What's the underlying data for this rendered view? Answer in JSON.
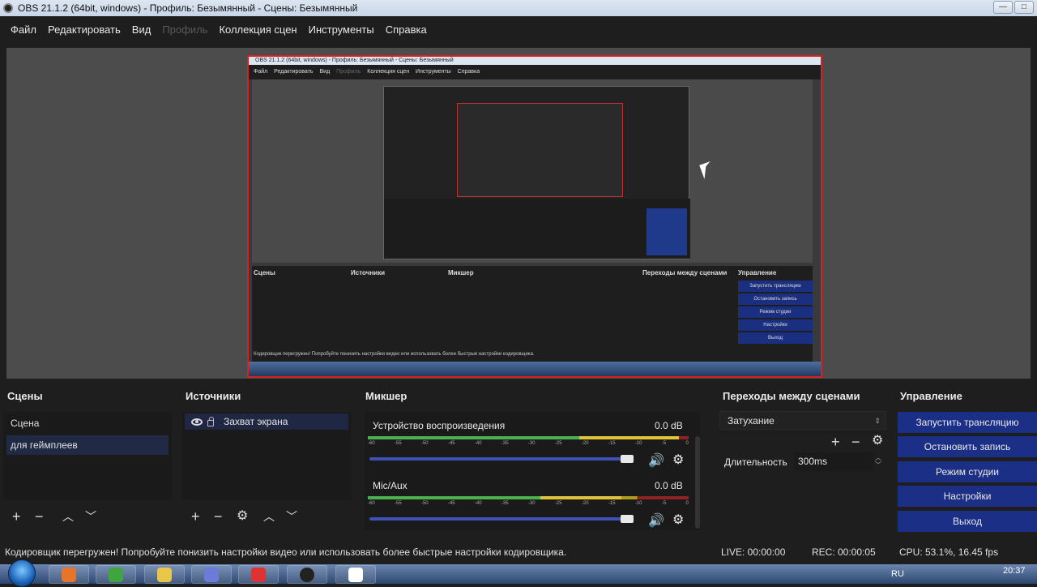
{
  "window": {
    "title": "OBS 21.1.2 (64bit, windows) - Профиль: Безымянный - Сцены: Безымянный",
    "minimize": "—",
    "maximize": "□"
  },
  "menu": [
    {
      "label": "Файл",
      "enabled": true
    },
    {
      "label": "Редактировать",
      "enabled": true
    },
    {
      "label": "Вид",
      "enabled": true
    },
    {
      "label": "Профиль",
      "enabled": false
    },
    {
      "label": "Коллекция сцен",
      "enabled": true
    },
    {
      "label": "Инструменты",
      "enabled": true
    },
    {
      "label": "Справка",
      "enabled": true
    }
  ],
  "nested_preview": {
    "title": "OBS 21.1.2 (64bit, windows) - Профиль: Безымянный - Сцены: Безымянный",
    "menu": [
      "Файл",
      "Редактировать",
      "Вид",
      "Профиль",
      "Коллекция сцен",
      "Инструменты",
      "Справка"
    ],
    "dock_titles": [
      "Сцены",
      "Источники",
      "Микшер",
      "Переходы между сценами",
      "Управление"
    ],
    "buttons": [
      "Запустить трансляцию",
      "Остановить запись",
      "Режим студии",
      "Настройки",
      "Выход"
    ],
    "status": "Кодировщик перегружен! Попробуйте понизить настройки видео или использовать более быстрые настройки кодировщика."
  },
  "docks": {
    "scenes": {
      "title": "Сцены",
      "items": [
        {
          "label": "Сцена",
          "selected": false
        },
        {
          "label": "для геймплеев",
          "selected": true
        }
      ]
    },
    "sources": {
      "title": "Источники",
      "items": [
        {
          "label": "Захват экрана",
          "visible": true,
          "locked": false
        }
      ]
    },
    "mixer": {
      "title": "Микшер",
      "scale_labels": [
        "-60",
        "-55",
        "-50",
        "-45",
        "-40",
        "-35",
        "-30",
        "-25",
        "-20",
        "-15",
        "-10",
        "-5",
        "0"
      ],
      "tracks": [
        {
          "name": "Устройство воспроизведения",
          "db": "0.0 dB",
          "level": 0.97,
          "volume": 1.0
        },
        {
          "name": "Mic/Aux",
          "db": "0.0 dB",
          "level": 0.79,
          "volume": 1.0
        }
      ]
    },
    "transitions": {
      "title": "Переходы между сценами",
      "selected": "Затухание",
      "duration_label": "Длительность",
      "duration_value": "300ms"
    },
    "controls": {
      "title": "Управление",
      "buttons": [
        "Запустить трансляцию",
        "Остановить запись",
        "Режим студии",
        "Настройки",
        "Выход"
      ]
    }
  },
  "status": {
    "message": "Кодировщик перегружен! Попробуйте понизить настройки видео или использовать более быстрые настройки кодировщика.",
    "live": "LIVE: 00:00:00",
    "rec": "REC: 00:00:05",
    "cpu": "CPU: 53.1%, 16.45 fps"
  },
  "taskbar": {
    "language": "RU",
    "time": "20:37"
  },
  "colors": {
    "accent_blue": "#1c2f86",
    "selection_red": "#d62121"
  }
}
